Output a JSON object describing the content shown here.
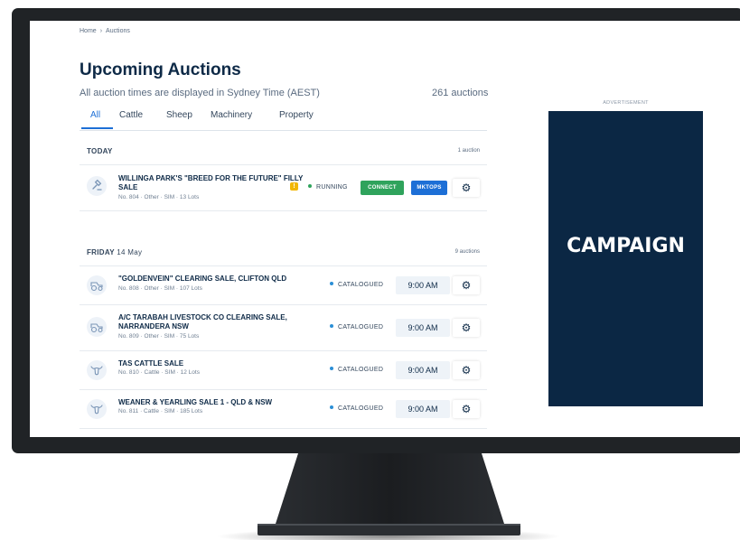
{
  "breadcrumb": {
    "home": "Home",
    "separator": "›",
    "current": "Auctions"
  },
  "page": {
    "title": "Upcoming Auctions",
    "subtitle": "All auction times are displayed in Sydney Time (AEST)",
    "count": "261 auctions"
  },
  "tabs": [
    {
      "label": "All",
      "active": true
    },
    {
      "label": "Cattle"
    },
    {
      "label": "Sheep"
    },
    {
      "label": "Machinery"
    },
    {
      "label": "Property"
    }
  ],
  "sections": [
    {
      "day": "TODAY",
      "date": "",
      "count": "1 auction",
      "rows": [
        {
          "icon": "gavel-icon",
          "name": "WILLINGA PARK'S \"BREED FOR THE FUTURE\" FILLY SALE",
          "meta": "No. 804 · Other · SIM · 13 Lots",
          "status": "RUNNING",
          "status_color": "#2fa35c",
          "warning": "!",
          "connect_label": "CONNECT",
          "mktops_label": "MKTOPS"
        }
      ]
    },
    {
      "day": "FRIDAY",
      "date": "14 May",
      "count": "9 auctions",
      "rows": [
        {
          "icon": "tractor-icon",
          "name": "\"GOLDENVEIN\" CLEARING SALE, CLIFTON QLD",
          "meta": "No. 808 · Other · SIM · 107 Lots",
          "status": "CATALOGUED",
          "time": "9:00 AM"
        },
        {
          "icon": "tractor-icon",
          "name": "A/C TARABAH LIVESTOCK CO CLEARING SALE, NARRANDERA NSW",
          "meta": "No. 809 · Other · SIM · 75 Lots",
          "status": "CATALOGUED",
          "time": "9:00 AM"
        },
        {
          "icon": "cattle-icon",
          "name": "TAS CATTLE SALE",
          "meta": "No. 810 · Cattle · SIM · 12 Lots",
          "status": "CATALOGUED",
          "time": "9:00 AM"
        },
        {
          "icon": "cattle-icon",
          "name": "WEANER & YEARLING SALE 1 - QLD & NSW",
          "meta": "No. 811 · Cattle · SIM · 185 Lots",
          "status": "CATALOGUED",
          "time": "9:00 AM"
        }
      ]
    }
  ],
  "catalogued_color": "#2b8fd6",
  "ad": {
    "label": "ADVERTISEMENT",
    "text": "CAMPAIGN",
    "background": "#0b2744"
  }
}
